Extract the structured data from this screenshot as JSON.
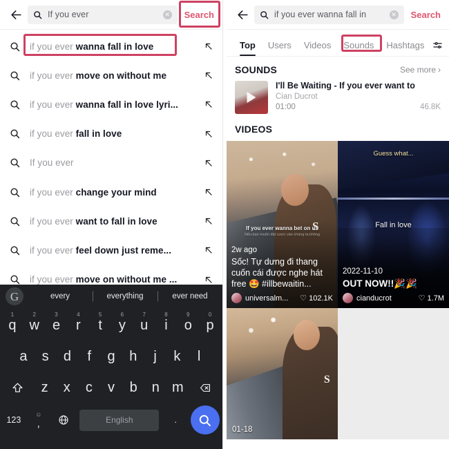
{
  "left": {
    "search": {
      "value": "If you ever",
      "action_label": "Search",
      "clear_label": "✕",
      "back_name": "back-arrow"
    },
    "suggestions": [
      {
        "prefix": "if you ever ",
        "bold": "wanna fall in love",
        "highlighted": true
      },
      {
        "prefix": "if you ever ",
        "bold": "move on without me",
        "highlighted": false
      },
      {
        "prefix": "if you ever ",
        "bold": "wanna fall in love lyri...",
        "highlighted": false
      },
      {
        "prefix": "if you ever ",
        "bold": "fall in love",
        "highlighted": false
      },
      {
        "prefix": "If you ever",
        "bold": "",
        "highlighted": false
      },
      {
        "prefix": "if you ever ",
        "bold": "change your mind",
        "highlighted": false
      },
      {
        "prefix": "if you ever ",
        "bold": "want to fall in love",
        "highlighted": false
      },
      {
        "prefix": "if you ever ",
        "bold": "feel down just reme...",
        "highlighted": false
      },
      {
        "prefix": "if you ever ",
        "bold": "move on without me ...",
        "highlighted": false
      }
    ],
    "keyboard": {
      "logo": "G",
      "suggestions": [
        "every",
        "everything",
        "ever need"
      ],
      "row1": [
        {
          "key": "q",
          "num": "1"
        },
        {
          "key": "w",
          "num": "2"
        },
        {
          "key": "e",
          "num": "3"
        },
        {
          "key": "r",
          "num": "4"
        },
        {
          "key": "t",
          "num": "5"
        },
        {
          "key": "y",
          "num": "6"
        },
        {
          "key": "u",
          "num": "7"
        },
        {
          "key": "i",
          "num": "8"
        },
        {
          "key": "o",
          "num": "9"
        },
        {
          "key": "p",
          "num": "0"
        }
      ],
      "row2": [
        "a",
        "s",
        "d",
        "f",
        "g",
        "h",
        "j",
        "k",
        "l"
      ],
      "row3": [
        "z",
        "x",
        "c",
        "v",
        "b",
        "n",
        "m"
      ],
      "shift_label": "⇧",
      "backspace_label": "⌧",
      "numeric_label": "123",
      "symbol_top": "☺",
      "symbol_bottom": ",",
      "globe_label": "🌐",
      "space_label": "English",
      "period_label": ".",
      "enter_label": "search"
    }
  },
  "right": {
    "search": {
      "value": "if you ever wanna fall in",
      "action_label": "Search",
      "clear_label": "✕"
    },
    "tabs": [
      {
        "label": "Top",
        "active": true
      },
      {
        "label": "Users",
        "active": false
      },
      {
        "label": "Videos",
        "active": false
      },
      {
        "label": "Sounds",
        "active": false,
        "highlighted": true
      },
      {
        "label": "Hashtags",
        "active": false
      }
    ],
    "sounds": {
      "heading": "SOUNDS",
      "see_more": "See more",
      "chevron": "›",
      "item": {
        "title": "I'll Be Waiting - If you ever want to",
        "artist": "Cian Ducrot",
        "duration": "01:00",
        "plays": "46.8K"
      }
    },
    "videos": {
      "heading": "VIDEOS",
      "items": [
        {
          "overlay_caption": "If you ever wanna bet on us",
          "overlay_subcaption": "Nếu bạn muốn đặt cược vào chúng ta không",
          "date": "2w ago",
          "title": "Sốc! Tự dưng đi thang cuốn cái được nghe hát free 🤩 #illbewaitin...",
          "user": "universalm...",
          "likes": "102.1K",
          "heart": "♡"
        },
        {
          "caption_top": "Guess what...",
          "caption_center": "Fall in love",
          "date": "2022-11-10",
          "title": "OUT NOW!!🎉🎉",
          "user": "cianducrot",
          "likes": "1.7M",
          "heart": "♡"
        },
        {
          "time_label": "01-18"
        }
      ]
    }
  }
}
